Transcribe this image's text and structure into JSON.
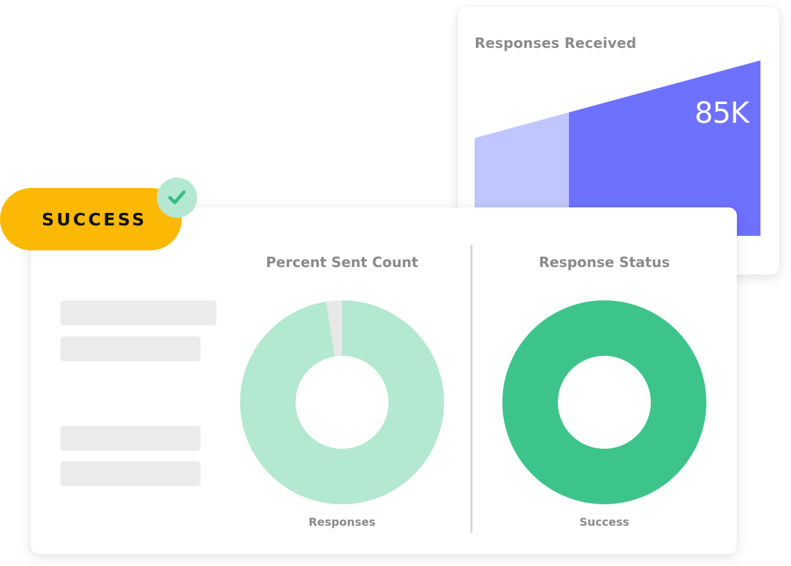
{
  "responses_card": {
    "title": "Responses Received",
    "value": "85K"
  },
  "status_badge": {
    "label": "SUCCESS",
    "icon": "check-icon"
  },
  "percent_sent": {
    "title": "Percent Sent Count",
    "caption": "Responses"
  },
  "response_status": {
    "title": "Response Status",
    "caption": "Success"
  },
  "colors": {
    "funnel_light": "#bfc7fe",
    "funnel_dark": "#6e71fe",
    "badge_yellow": "#fbb905",
    "donut_light_green": "#b3e8d1",
    "donut_gray": "#e8e8e8",
    "donut_green": "#3dc48b",
    "check_green": "#3dba86"
  },
  "chart_data": [
    {
      "type": "area",
      "title": "Responses Received",
      "series": [
        {
          "values": []
        }
      ],
      "annotation": "85K"
    },
    {
      "type": "pie",
      "title": "Percent Sent Count",
      "slices": [
        {
          "label": "Responses",
          "value": 97.5
        },
        {
          "value": 2.5
        }
      ],
      "caption": "Responses"
    },
    {
      "type": "pie",
      "title": "Response Status",
      "slices": [
        {
          "label": "Success",
          "value": 100
        }
      ],
      "caption": "Success"
    }
  ]
}
